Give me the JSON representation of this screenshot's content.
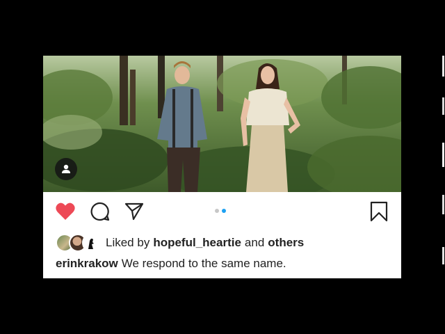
{
  "post": {
    "icons": {
      "like": "heart-icon",
      "comment": "comment-icon",
      "share": "send-icon",
      "save": "bookmark-icon",
      "tag": "user-tag-icon"
    },
    "colors": {
      "like_active": "#ed4956",
      "dot_active": "#1da1f2",
      "dot_inactive": "#c7c7c7"
    },
    "carousel": {
      "total": 2,
      "current": 2
    },
    "likes": {
      "prefix": "Liked by",
      "user": "hopeful_heartie",
      "connector": "and",
      "others": "others"
    },
    "caption": {
      "username": "erinkrakow",
      "text": "We respond to the same name."
    }
  }
}
